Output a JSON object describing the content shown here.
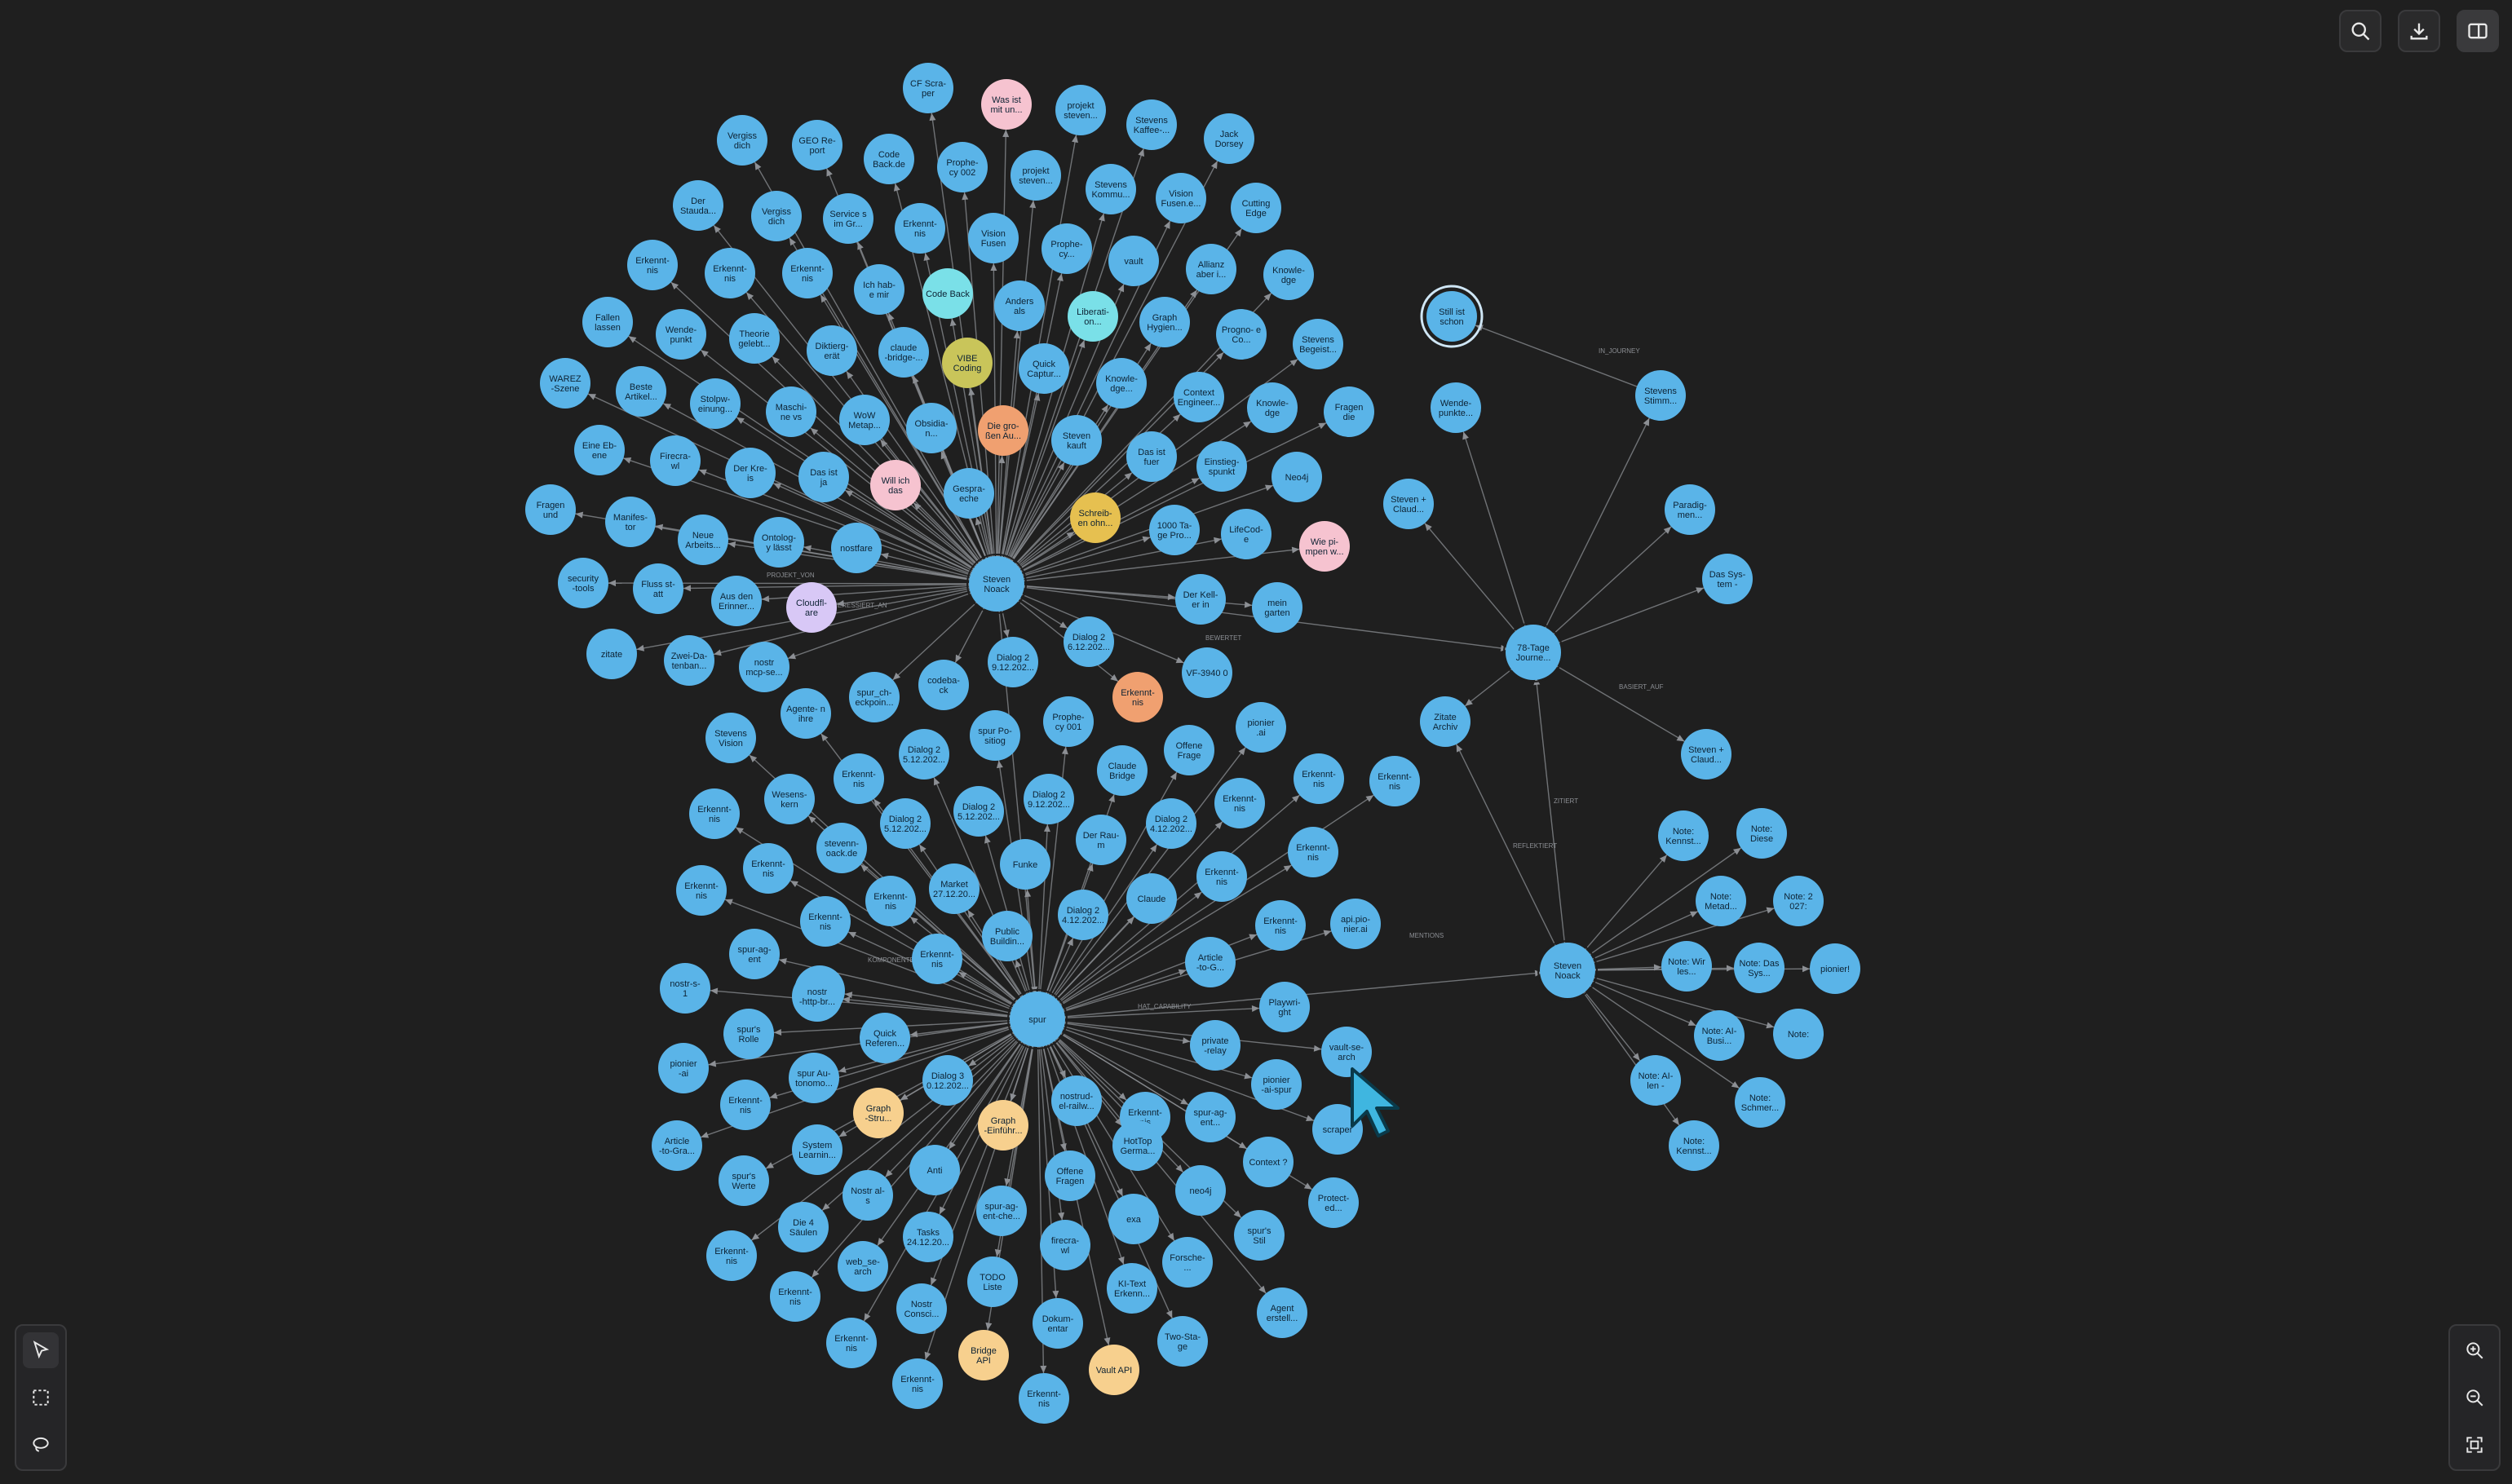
{
  "toolbar": {
    "search_icon": "search-icon",
    "download_icon": "download-icon",
    "panel_icon": "sidebar-panel-icon"
  },
  "tools": {
    "select_icon": "pointer-icon",
    "marquee_icon": "marquee-select-icon",
    "lasso_icon": "lasso-icon"
  },
  "zoom": {
    "in_icon": "zoom-in-icon",
    "out_icon": "zoom-out-icon",
    "fit_icon": "fit-view-icon"
  },
  "colors": {
    "background": "#1f1f1f",
    "node_default": "#5ab4e8",
    "node_pink": "#f6c3d0",
    "node_cyan": "#7ae0e8",
    "node_olive": "#c9c55a",
    "node_orange": "#f0a070",
    "node_purple": "#d8c8f6",
    "node_peach": "#f7d08e",
    "node_gold": "#e6c050",
    "edge": "#8c8f94"
  },
  "graph": {
    "hubs": [
      {
        "id": "sn1",
        "label": "Steven Noack"
      },
      {
        "id": "spur",
        "label": "spur"
      },
      {
        "id": "sn2",
        "label": "Steven Noack"
      },
      {
        "id": "tage",
        "label": "78-Tage Journe..."
      }
    ],
    "nodes": [
      [
        "CF Scra- per Wor...",
        "default"
      ],
      [
        "Was ist mit un...",
        "pink"
      ],
      [
        "projekt steven...",
        "default"
      ],
      [
        "Stevens Kaffee-...",
        "default"
      ],
      [
        "Jack Dorsey",
        "default"
      ],
      [
        "Vergiss dich ni...",
        "default"
      ],
      [
        "GEO Re- port US...",
        "default"
      ],
      [
        "Code Back.de",
        "default"
      ],
      [
        "Prophe- cy 002 -...",
        "default"
      ],
      [
        "projekt steven...",
        "default"
      ],
      [
        "Stevens Kommu...",
        "default"
      ],
      [
        "Vision Fusen.e...",
        "default"
      ],
      [
        "Cutting Edge Al...",
        "default"
      ],
      [
        "Der Stauda...",
        "default"
      ],
      [
        "Vergiss dich ni...",
        "default"
      ],
      [
        "Service s im Gr...",
        "default"
      ],
      [
        "Erkennt- nis 25.1...",
        "default"
      ],
      [
        "Vision Fusen",
        "default"
      ],
      [
        "Prophe- cy...",
        "default"
      ],
      [
        "vault",
        "default"
      ],
      [
        "Allianz aber i...",
        "default"
      ],
      [
        "Knowle- dge Gra...",
        "default"
      ],
      [
        "Erkennt- nis 27.1...",
        "default"
      ],
      [
        "Erkennt- nis 25.1...",
        "default"
      ],
      [
        "Erkennt- nis 25.1...",
        "default"
      ],
      [
        "Ich hab- e mir so...",
        "default"
      ],
      [
        "Code Back",
        "cyan"
      ],
      [
        "Anders als die...",
        "default"
      ],
      [
        "Liberati- on...",
        "cyan"
      ],
      [
        "Graph Hygien...",
        "default"
      ],
      [
        "Progno- e Co...",
        "default"
      ],
      [
        "Stevens Begeist...",
        "default"
      ],
      [
        "Fallen lassen i...",
        "default"
      ],
      [
        "Wende- punkt 2...",
        "default"
      ],
      [
        "Theorie gelebt...",
        "default"
      ],
      [
        "Diktierg- erät ma...",
        "default"
      ],
      [
        "claude -bridge-...",
        "default"
      ],
      [
        "VIBE Coding",
        "olive"
      ],
      [
        "Quick Captur...",
        "default"
      ],
      [
        "Knowle- dge...",
        "default"
      ],
      [
        "Context Engineer...",
        "default"
      ],
      [
        "Knowle- dge Gra...",
        "default"
      ],
      [
        "Fragen die alle...",
        "default"
      ],
      [
        "WAREZ -Szene",
        "default"
      ],
      [
        "Beste Artikel...",
        "default"
      ],
      [
        "Stolpw- einung...",
        "default"
      ],
      [
        "Maschi- ne vs In...",
        "default"
      ],
      [
        "WoW Metap...",
        "default"
      ],
      [
        "Obsidia- n...",
        "default"
      ],
      [
        "Die gro- ßen Au...",
        "orange"
      ],
      [
        "Steven kauft f...",
        "default"
      ],
      [
        "Das ist fuer mi...",
        "default"
      ],
      [
        "Einstieg- spunkt",
        "default"
      ],
      [
        "Neo4j",
        "default"
      ],
      [
        "Eine Eb- ene hoe...",
        "default"
      ],
      [
        "Firecra- wl gewi...",
        "default"
      ],
      [
        "Der Kre- is schlie...",
        "default"
      ],
      [
        "Das ist ja scho...",
        "default"
      ],
      [
        "Will ich das wis...",
        "pink"
      ],
      [
        "Gespra- eche fre...",
        "default"
      ],
      [
        "Schreib- en ohn...",
        "gold"
      ],
      [
        "1000 Ta- ge Pro...",
        "default"
      ],
      [
        "LifeCod- e",
        "default"
      ],
      [
        "Wie pi- mpen w...",
        "pink"
      ],
      [
        "Fragen und Tai...",
        "default"
      ],
      [
        "Manifes- tor Quo...",
        "default"
      ],
      [
        "Neue Arbeits...",
        "default"
      ],
      [
        "Ontolog- y lässt St...",
        "default"
      ],
      [
        "nostfare",
        "default"
      ],
      [
        "security -tools",
        "default"
      ],
      [
        "Fluss st- att Absi...",
        "default"
      ],
      [
        "Aus den Erinner...",
        "default"
      ],
      [
        "Cloudfl- are",
        "purple"
      ],
      [
        "Der Kell- er in Br...",
        "default"
      ],
      [
        "mein garten",
        "default"
      ],
      [
        "zitate",
        "default"
      ],
      [
        "Zwei-Da- tenban...",
        "default"
      ],
      [
        "nostr mcp-se...",
        "default"
      ],
      [
        "Dialog 2 9.12.202...",
        "default"
      ],
      [
        "Dialog 2 6.12.202...",
        "default"
      ],
      [
        "VF-3940 0",
        "default"
      ],
      [
        "Stevens Vision f...",
        "default"
      ],
      [
        "Agente- n ihre ei...",
        "default"
      ],
      [
        "spur_ch- eckpoin...",
        "default"
      ],
      [
        "codeba- ck",
        "default"
      ],
      [
        "Erkennt- nis 25.1...",
        "orange"
      ],
      [
        "Prophe- cy 001 -...",
        "default"
      ],
      [
        "pionier .ai",
        "default"
      ],
      [
        "Erkennt- nis 25.1...",
        "default"
      ],
      [
        "Wesens- kern Ag...",
        "default"
      ],
      [
        "Erkennt- nis 24.1...",
        "default"
      ],
      [
        "Dialog 2 5.12.202...",
        "default"
      ],
      [
        "spur Po- sitiog A...",
        "default"
      ],
      [
        "Claude Bridge",
        "default"
      ],
      [
        "Offene Frage -...",
        "default"
      ],
      [
        "Erkennt- nis 31.1...",
        "default"
      ],
      [
        "Erkennt- nis 31.1...",
        "default"
      ],
      [
        "Erkennt- nis 28.1...",
        "default"
      ],
      [
        "stevenn- oack.de",
        "default"
      ],
      [
        "Dialog 2 5.12.202...",
        "default"
      ],
      [
        "Dialog 2 5.12.202...",
        "default"
      ],
      [
        "Dialog 2 9.12.202...",
        "default"
      ],
      [
        "Der Rau- m Zwisc...",
        "default"
      ],
      [
        "Dialog 2 4.12.202...",
        "default"
      ],
      [
        "Erkennt- nis 31.1...",
        "default"
      ],
      [
        "Erkennt- nis 31.1...",
        "default"
      ],
      [
        "Erkennt- nis 25.1...",
        "default"
      ],
      [
        "Erkennt- nis 29.1...",
        "default"
      ],
      [
        "Erkennt- nis 28.1...",
        "default"
      ],
      [
        "Market 27.12.20...",
        "default"
      ],
      [
        "Funke",
        "default"
      ],
      [
        "Dialog 2 4.12.202...",
        "default"
      ],
      [
        "Claude",
        "default"
      ],
      [
        "Erkennt- nis 30.1...",
        "default"
      ],
      [
        "Erkennt- nis 30.1...",
        "default"
      ],
      [
        "spur-ag- ent",
        "default"
      ],
      [
        "Erkennt- nis 28.1...",
        "default"
      ],
      [
        "Erkennt- nis 28.1...",
        "default"
      ],
      [
        "Public Buildin...",
        "default"
      ],
      [
        "Article -to-G...",
        "default"
      ],
      [
        "api.pio- nier.ai",
        "default"
      ],
      [
        "nostr-s- 1",
        "default"
      ],
      [
        "nostr -http-br...",
        "default"
      ],
      [
        "Quick Referen...",
        "default"
      ],
      [
        "Playwri- ght Bro...",
        "default"
      ],
      [
        "vault-se- arch",
        "default"
      ],
      [
        "spur's Rolle",
        "default"
      ],
      [
        "pionier -ai GitH...",
        "default"
      ],
      [
        "spur Au- tonomo...",
        "default"
      ],
      [
        "Dialog 3 0.12.202...",
        "default"
      ],
      [
        "private -relay",
        "default"
      ],
      [
        "pionier -ai-spur",
        "default"
      ],
      [
        "Erkennt- nis 27.1...",
        "default"
      ],
      [
        "Graph -Stru...",
        "peach"
      ],
      [
        "Graph -Einführ...",
        "peach"
      ],
      [
        "nostrud- el-railw...",
        "default"
      ],
      [
        "Erkennt- nis 27.1...",
        "default"
      ],
      [
        "spur-ag- ent...",
        "default"
      ],
      [
        "scraper",
        "default"
      ],
      [
        "Article -to-Gra...",
        "default"
      ],
      [
        "System Learnin...",
        "default"
      ],
      [
        "Anti",
        "default"
      ],
      [
        "HotTop Germa...",
        "default"
      ],
      [
        "Context ?",
        "default"
      ],
      [
        "spur's Werte",
        "default"
      ],
      [
        "Nostr al- s vertei...",
        "default"
      ],
      [
        "Offene Fragen",
        "default"
      ],
      [
        "neo4j",
        "default"
      ],
      [
        "Protect- ed...",
        "default"
      ],
      [
        "Die 4 Säulen",
        "default"
      ],
      [
        "spur-ag- ent-che...",
        "default"
      ],
      [
        "exa",
        "default"
      ],
      [
        "spur's Stil",
        "default"
      ],
      [
        "Erkennt- nis 2025...",
        "default"
      ],
      [
        "Tasks 24.12.20...",
        "default"
      ],
      [
        "web_se- arch",
        "default"
      ],
      [
        "firecra- wl",
        "default"
      ],
      [
        "Forsche- ...",
        "default"
      ],
      [
        "Agent erstell...",
        "default"
      ],
      [
        "Erkennt- nis 28.1...",
        "default"
      ],
      [
        "Nostr Consci...",
        "default"
      ],
      [
        "TODO Liste",
        "default"
      ],
      [
        "KI-Text Erkenn...",
        "default"
      ],
      [
        "Two-Sta- ge Refle...",
        "default"
      ],
      [
        "Erkennt- nis 28.1...",
        "default"
      ],
      [
        "Dokum- entar",
        "default"
      ],
      [
        "Bridge API",
        "peach"
      ],
      [
        "Vault API",
        "peach"
      ],
      [
        "Erkennt- nis 30.1...",
        "default"
      ],
      [
        "Erkennt- nis 27.1...",
        "default"
      ]
    ],
    "satellite_nodes": [
      [
        "Still ist schon i...",
        "default"
      ],
      [
        "Wende- punkte...",
        "default"
      ],
      [
        "Stevens Stimm...",
        "default"
      ],
      [
        "Steven + Claud...",
        "default"
      ],
      [
        "Paradig- men...",
        "default"
      ],
      [
        "Das Sys- tem - St...",
        "default"
      ],
      [
        "Zitate Archiv",
        "default"
      ],
      [
        "Steven + Claud...",
        "default"
      ],
      [
        "Note: Kennst...",
        "default"
      ],
      [
        "Note: Diese e...",
        "default"
      ],
      [
        "Note: Metad...",
        "default"
      ],
      [
        "Note: 2 027: Ein...",
        "default"
      ],
      [
        "Note: Wir les...",
        "default"
      ],
      [
        "Note: Das Sys...",
        "default"
      ],
      [
        "pionier!",
        "default"
      ],
      [
        "Note: AI- Busi...",
        "default"
      ],
      [
        "Note:",
        "default"
      ],
      [
        "Note: AI- len - ein...",
        "default"
      ],
      [
        "Note: Schmer...",
        "default"
      ],
      [
        "Note: Kennst...",
        "default"
      ]
    ],
    "edge_labels": [
      "PROJEKT_VON",
      "INTERESSIERT_AN",
      "HAT_CAPABILITY",
      "KOMPONENTE_VON",
      "BEWERTET",
      "IN_JOURNEY",
      "ZITIERT",
      "MENTIONS",
      "REFLEKTIERT",
      "BASIERT_AUF"
    ]
  }
}
